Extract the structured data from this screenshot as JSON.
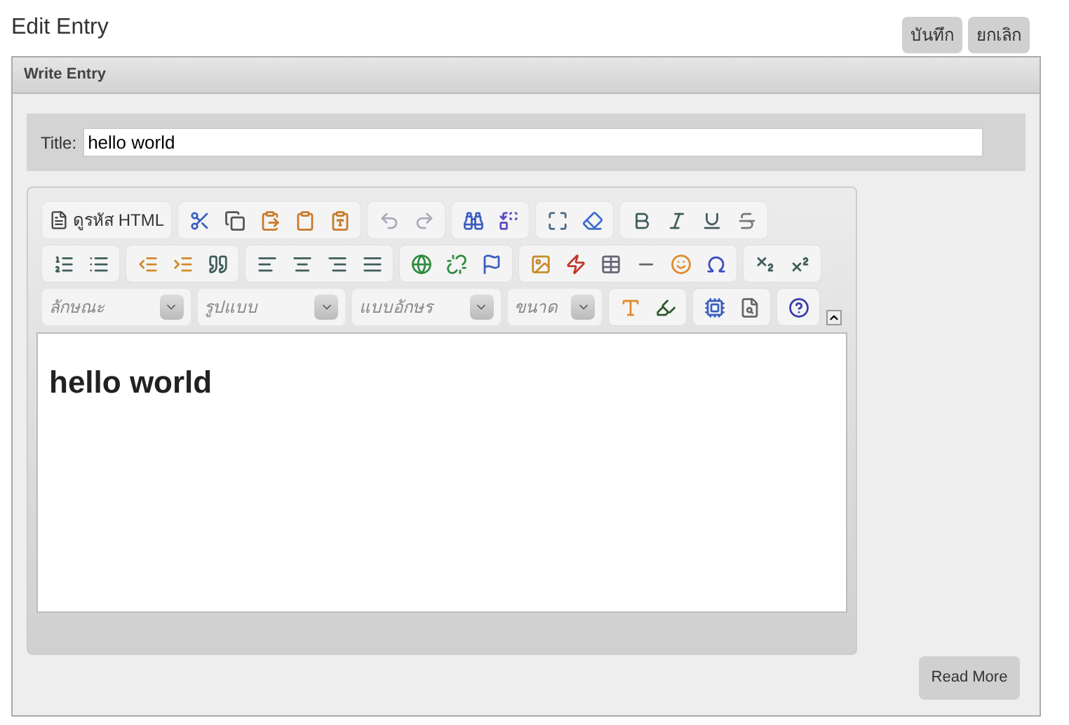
{
  "page_title": "Edit Entry",
  "actions": [
    {
      "label": "บันทึก"
    },
    {
      "label": "ยกเลิก"
    }
  ],
  "panel": {
    "title": "Write Entry",
    "title_field": {
      "label": "Title:",
      "value": "hello world"
    },
    "editor": {
      "source_button": "ดูรหัส HTML",
      "dropdowns": [
        {
          "placeholder": "ลักษณะ"
        },
        {
          "placeholder": "รูปแบบ"
        },
        {
          "placeholder": "แบบอักษร"
        },
        {
          "placeholder": "ขนาด"
        }
      ],
      "content_heading": "hello world"
    },
    "read_more": "Read More"
  }
}
